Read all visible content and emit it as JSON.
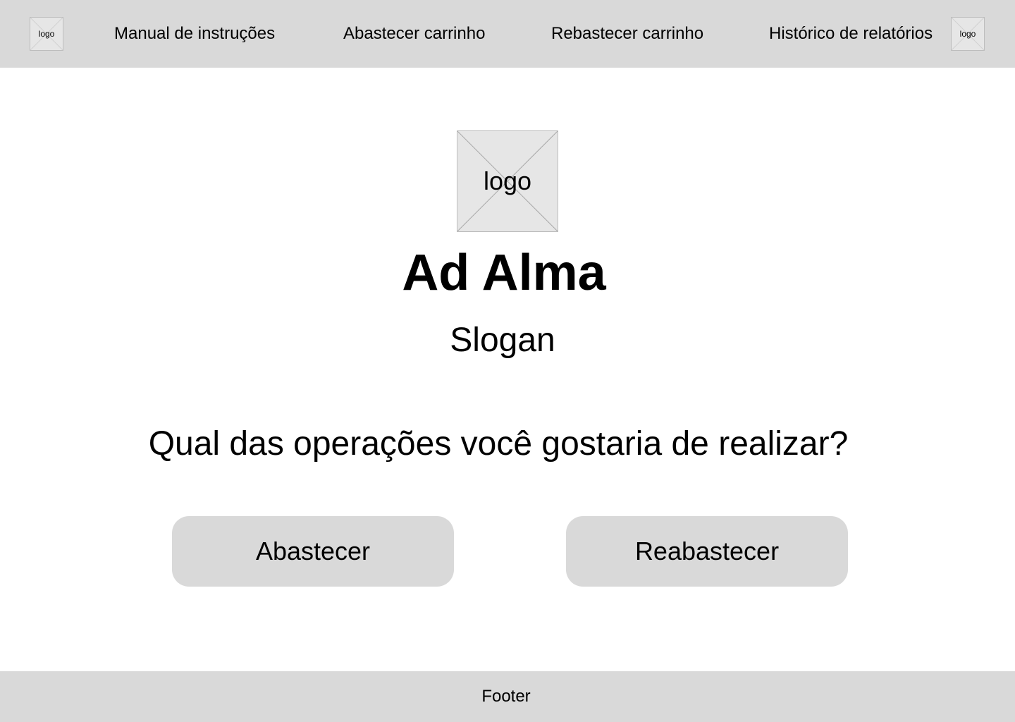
{
  "header": {
    "left_logo_label": "logo",
    "right_logo_label": "logo",
    "nav": [
      {
        "label": "Manual de instruções"
      },
      {
        "label": "Abastecer carrinho"
      },
      {
        "label": "Rebastecer carrinho"
      },
      {
        "label": "Histórico de relatórios"
      }
    ]
  },
  "hero": {
    "logo_label": "logo",
    "title": "Ad Alma",
    "slogan": "Slogan"
  },
  "main": {
    "question": "Qual das operações você gostaria de realizar?",
    "actions": [
      {
        "label": "Abastecer"
      },
      {
        "label": "Reabastecer"
      }
    ]
  },
  "footer": {
    "text": "Footer"
  },
  "colors": {
    "bar_background": "#d9d9d9",
    "button_background": "#d9d9d9",
    "placeholder_fill": "#e6e6e6",
    "text": "#000000",
    "page_background": "#ffffff"
  }
}
